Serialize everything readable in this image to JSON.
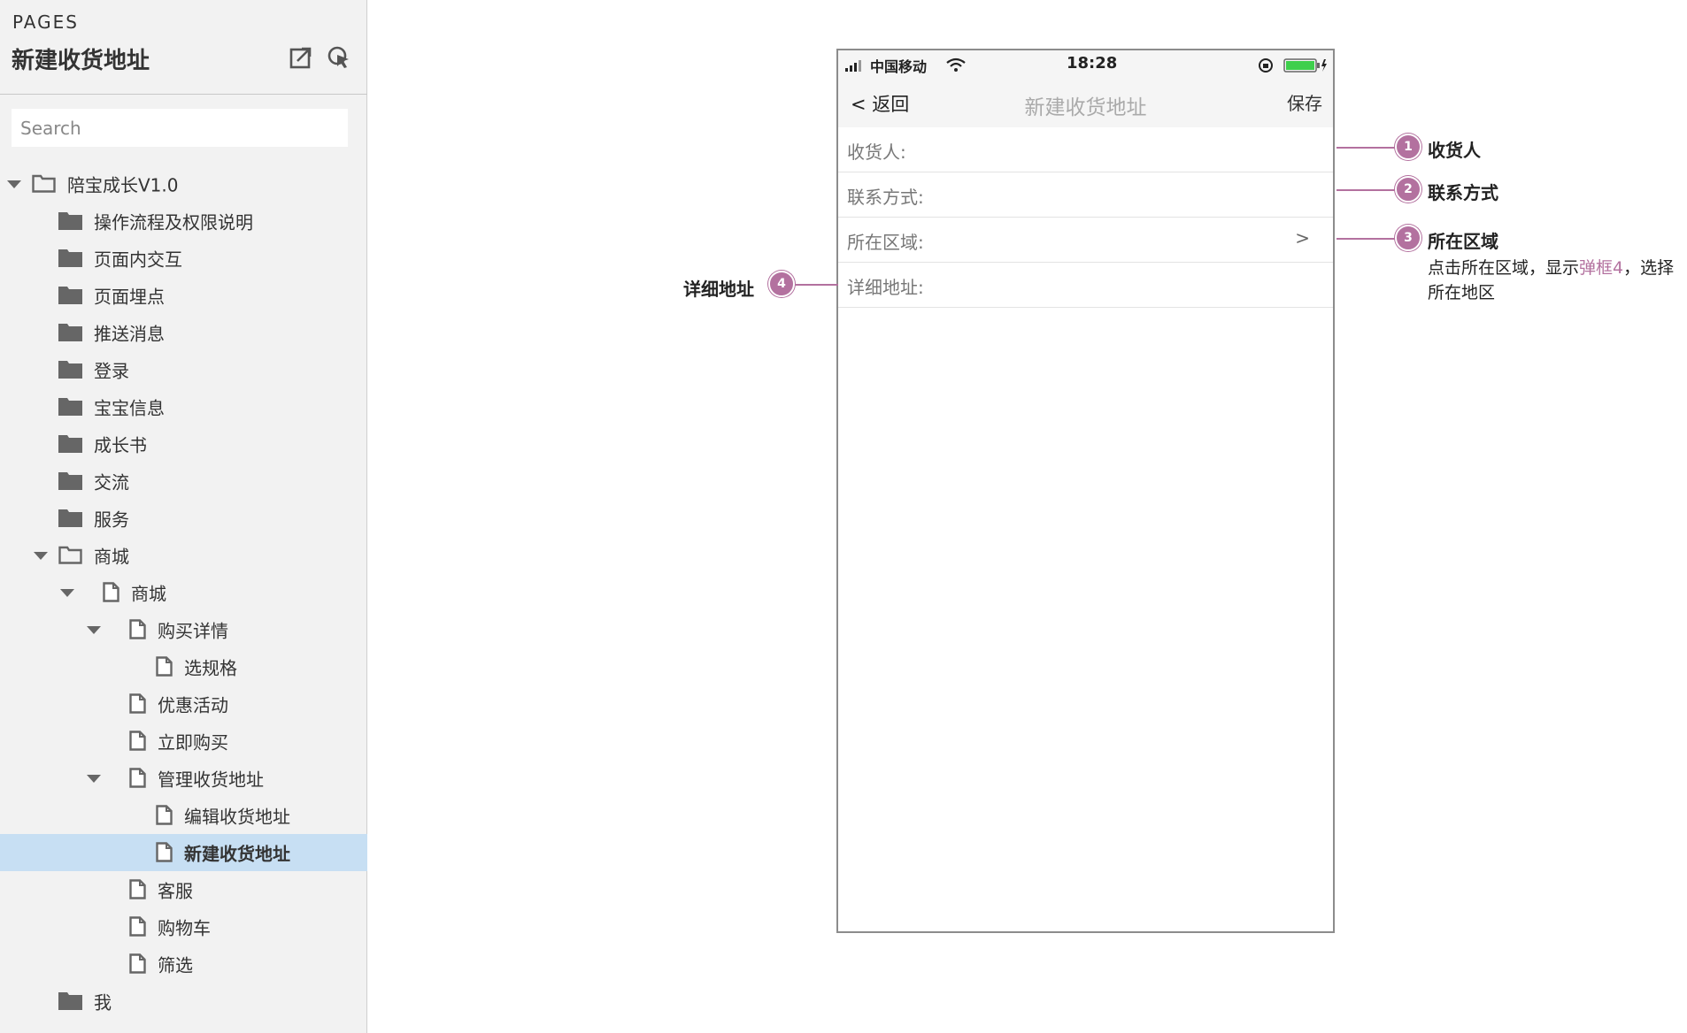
{
  "sidebar": {
    "pages_label": "PAGES",
    "title": "新建收货地址",
    "tools": [
      "export-icon",
      "pointer-icon"
    ],
    "search_placeholder": "Search",
    "tree": [
      {
        "label": "陪宝成长V1.0",
        "type": "folder",
        "level": 0,
        "expanded": true
      },
      {
        "label": "操作流程及权限说明",
        "type": "folder",
        "level": 1,
        "expanded": false
      },
      {
        "label": "页面内交互",
        "type": "folder",
        "level": 1,
        "expanded": false
      },
      {
        "label": "页面埋点",
        "type": "folder",
        "level": 1,
        "expanded": false
      },
      {
        "label": "推送消息",
        "type": "folder",
        "level": 1,
        "expanded": false
      },
      {
        "label": "登录",
        "type": "folder",
        "level": 1,
        "expanded": false
      },
      {
        "label": "宝宝信息",
        "type": "folder",
        "level": 1,
        "expanded": false
      },
      {
        "label": "成长书",
        "type": "folder",
        "level": 1,
        "expanded": false
      },
      {
        "label": "交流",
        "type": "folder",
        "level": 1,
        "expanded": false
      },
      {
        "label": "服务",
        "type": "folder",
        "level": 1,
        "expanded": false
      },
      {
        "label": "商城",
        "type": "folder",
        "level": 1,
        "expanded": true
      },
      {
        "label": "商城",
        "type": "page",
        "level": 2,
        "expanded": true
      },
      {
        "label": "购买详情",
        "type": "page",
        "level": 3,
        "expanded": true
      },
      {
        "label": "选规格",
        "type": "page",
        "level": 4
      },
      {
        "label": "优惠活动",
        "type": "page",
        "level": 3
      },
      {
        "label": "立即购买",
        "type": "page",
        "level": 3
      },
      {
        "label": "管理收货地址",
        "type": "page",
        "level": 3,
        "expanded": true
      },
      {
        "label": "编辑收货地址",
        "type": "page",
        "level": 4
      },
      {
        "label": "新建收货地址",
        "type": "page",
        "level": 4,
        "selected": true
      },
      {
        "label": "客服",
        "type": "page",
        "level": 3
      },
      {
        "label": "购物车",
        "type": "page",
        "level": 3
      },
      {
        "label": "筛选",
        "type": "page",
        "level": 3
      },
      {
        "label": "我",
        "type": "folder",
        "level": 1,
        "expanded": false
      }
    ]
  },
  "phone": {
    "status_bar": {
      "carrier": "中国移动",
      "time": "18:28"
    },
    "nav": {
      "back": "< 返回",
      "title": "新建收货地址",
      "save": "保存"
    },
    "form": [
      {
        "label": "收货人:"
      },
      {
        "label": "联系方式:"
      },
      {
        "label": "所在区域:",
        "arrow": ">"
      },
      {
        "label": "详细地址:"
      }
    ]
  },
  "annotations": [
    {
      "num": "1",
      "title": "收货人"
    },
    {
      "num": "2",
      "title": "联系方式"
    },
    {
      "num": "3",
      "title": "所在区域",
      "desc_pre": "点击所在区域，显示",
      "desc_link": "弹框4",
      "desc_post": "，选择所在地区"
    },
    {
      "num": "4",
      "title": "详细地址"
    }
  ],
  "colors": {
    "annotation": "#b3719f",
    "selected_row": "#c7dff3",
    "sidebar_bg": "#f2f2f2"
  }
}
